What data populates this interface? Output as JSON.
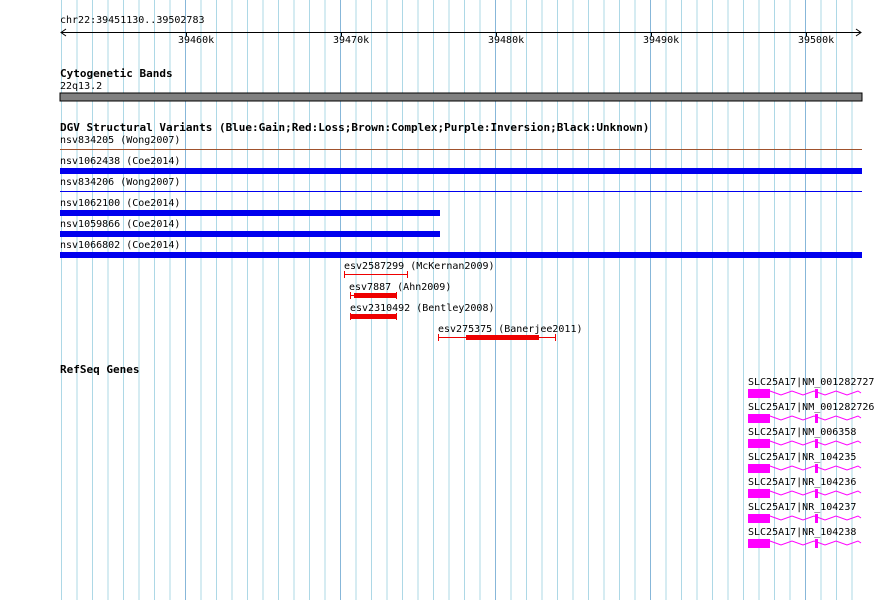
{
  "genome": {
    "location": "chr22:39451130..39502783",
    "tick_labels": [
      "39460k",
      "39470k",
      "39480k",
      "39490k",
      "39500k"
    ]
  },
  "tracks": {
    "cyto": {
      "title": "Cytogenetic Bands",
      "band": "22q13.2"
    },
    "dgv": {
      "title": "DGV Structural Variants (Blue:Gain;Red:Loss;Brown:Complex;Purple:Inversion;Black:Unknown)",
      "features": [
        {
          "label": "nsv834205 (Wong2007)",
          "type": "complex"
        },
        {
          "label": "nsv1062438 (Coe2014)",
          "type": "gain"
        },
        {
          "label": "nsv834206 (Wong2007)",
          "type": "gain"
        },
        {
          "label": "nsv1062100 (Coe2014)",
          "type": "gain"
        },
        {
          "label": "nsv1059866 (Coe2014)",
          "type": "gain"
        },
        {
          "label": "nsv1066802 (Coe2014)",
          "type": "gain"
        },
        {
          "label": "esv2587299 (McKernan2009)",
          "type": "loss"
        },
        {
          "label": "esv7887 (Ahn2009)",
          "type": "loss"
        },
        {
          "label": "esv2310492 (Bentley2008)",
          "type": "loss"
        },
        {
          "label": "esv275375 (Banerjee2011)",
          "type": "loss"
        }
      ]
    },
    "refseq": {
      "title": "RefSeq Genes",
      "transcripts": [
        {
          "label": "SLC25A17|NM_001282727"
        },
        {
          "label": "SLC25A17|NM_001282726"
        },
        {
          "label": "SLC25A17|NM_006358"
        },
        {
          "label": "SLC25A17|NR_104235"
        },
        {
          "label": "SLC25A17|NR_104236"
        },
        {
          "label": "SLC25A17|NR_104237"
        },
        {
          "label": "SLC25A17|NR_104238"
        }
      ]
    }
  },
  "colors": {
    "gain": "#0000ee",
    "loss": "#ee0000",
    "complex": "#a0522d",
    "gene": "#ff00ff",
    "grid": "#add8e6",
    "band": "#808080"
  }
}
